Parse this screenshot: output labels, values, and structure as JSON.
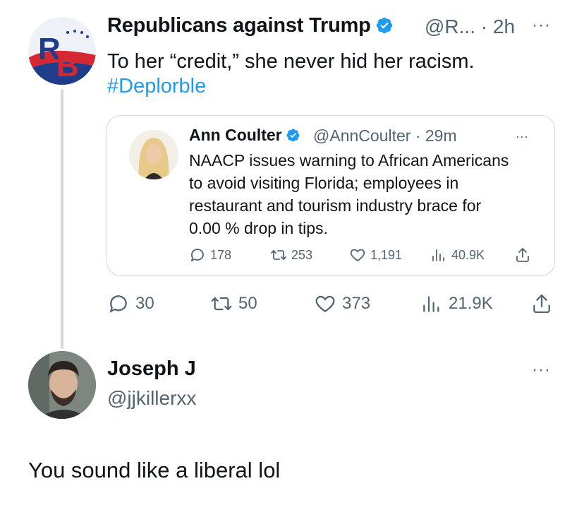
{
  "tweet": {
    "author_name": "Republicans against Trump",
    "author_handle": "@R...",
    "time": "· 2h",
    "more": "···",
    "text": "To her “credit,” she never hid her racism.",
    "hashtag": "#Deplorble",
    "avatar_icon": "rb-logo-icon",
    "stats": {
      "replies": "30",
      "retweets": "50",
      "likes": "373",
      "views": "21.9K"
    }
  },
  "quoted_tweet": {
    "author_name": "Ann Coulter",
    "author_handle": "@AnnCoulter",
    "time": "· 29m",
    "more": "···",
    "lines": [
      "NAACP issues warning to African Americans",
      "to avoid visiting Florida; employees in",
      "restaurant and tourism industry brace for",
      "0.00 % drop in tips."
    ],
    "stats": {
      "replies": "178",
      "retweets": "253",
      "likes": "1,191",
      "views": "40.9K"
    }
  },
  "reply": {
    "author_name": "Joseph J",
    "author_handle": "@jjkillerxx",
    "more": "···",
    "text": "You sound like a liberal lol"
  },
  "colors": {
    "link": "#1d9bf0",
    "muted": "#536471",
    "verified": "#1d9bf0",
    "text": "#0f1419",
    "border": "#cfd9de"
  }
}
